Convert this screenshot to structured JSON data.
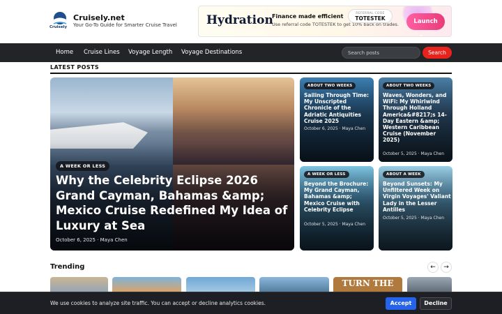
{
  "site": {
    "logo_caption": "Cruisely",
    "title": "Cruisely.net",
    "tagline": "Your Go-To Guide for Smarter Cruise Travel"
  },
  "ad": {
    "brand": "Hydration",
    "headline": "Finance made efficient",
    "sub": "Use referral code TOTESTEK to get 10% back on trades.",
    "ref_label": "REFERRAL CODE",
    "ref_code": "TOTESTEK",
    "cta": "Launch App"
  },
  "nav": {
    "items": [
      "Home",
      "Cruise Lines",
      "Voyage Length",
      "Voyage Destinations"
    ],
    "search_placeholder": "Search posts",
    "search_button": "Search"
  },
  "latest": {
    "section_title": "LATEST POSTS",
    "hero": {
      "badge": "A WEEK OR LESS",
      "title": "Why the Celebrity Eclipse 2026 Grand Cayman, Bahamas &amp; Mexico Cruise Redefined My Idea of Luxury at Sea",
      "meta": "October 6, 2025 · Maya Chen"
    },
    "cards": [
      {
        "badge": "ABOUT TWO WEEKS",
        "title": "Sailing Through Time: My Unscripted Chronicle of the Adriatic Antiquities Cruise 2025",
        "meta": "October 6, 2025 · Maya Chen"
      },
      {
        "badge": "ABOUT TWO WEEKS",
        "title": "Waves, Wonders, and WiFi: My Whirlwind Through Holland America&#8217;s 14-Day Eastern &amp; Western Caribbean Cruise (November 2025)",
        "meta": "October 5, 2025 · Maya Chen"
      },
      {
        "badge": "A WEEK OR LESS",
        "title": "Beyond the Brochure: My Grand Cayman, Bahamas &amp; Mexico Cruise with Celebrity Eclipse",
        "meta": "October 5, 2025 · Maya Chen"
      },
      {
        "badge": "ABOUT A WEEK",
        "title": "Beyond Sunsets: My Unfiltered Week on Virgin Voyages' Valiant Lady in the Lesser Antilles",
        "meta": "October 5, 2025 · Maya Chen"
      }
    ]
  },
  "trending": {
    "title": "Trending",
    "prev": "←",
    "next": "→",
    "thumb_text": "TURN THE TIDE"
  },
  "cookie": {
    "text": "We use cookies to analyze site traffic. You can accept or decline analytics cookies.",
    "accept": "Accept",
    "decline": "Decline"
  },
  "colors": {
    "nav_bg": "#222427",
    "search_button": "#e8231e",
    "accept_button": "#2563eb",
    "ad_cta": "#e93c7a"
  }
}
